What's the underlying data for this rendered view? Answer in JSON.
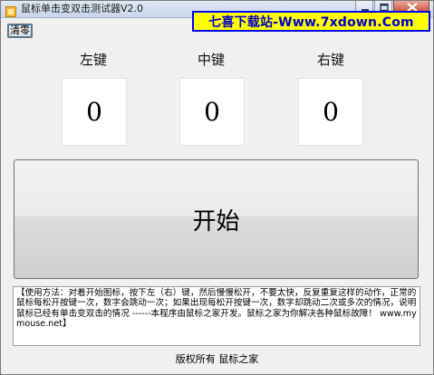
{
  "window": {
    "title": "鼠标单击变双击测试器V2.0"
  },
  "watermark": {
    "text": "七喜下载站-Www.7xdown.Com"
  },
  "toolbar": {
    "clear_label": "清零"
  },
  "keys": [
    {
      "label": "左键",
      "count": "0"
    },
    {
      "label": "中键",
      "count": "0"
    },
    {
      "label": "右键",
      "count": "0"
    }
  ],
  "start": {
    "label": "开始"
  },
  "instructions": {
    "text": "【使用方法：对着开始图标，按下左（右）键，然后慢慢松开，不要太快，反复重复这样的动作，正常的鼠标每松开按键一次，数字会跳动一次；如果出现每松开按键一次，数字却跳动二次或多次的情况，说明鼠标已经有单击变双击的情况 ------本程序由鼠标之家开发。鼠标之家为你解决各种鼠标故障！ www.mymouse.net】"
  },
  "footer": {
    "text": "版权所有 鼠标之家"
  },
  "colors": {
    "watermark_bg": "#ffff00",
    "watermark_border": "#0000ff",
    "watermark_text": "#0000c8",
    "close_button": "#c8462f"
  },
  "icons": {
    "app": "mouse-app-icon",
    "minimize": "minimize-icon",
    "maximize": "maximize-icon",
    "close": "close-icon"
  }
}
